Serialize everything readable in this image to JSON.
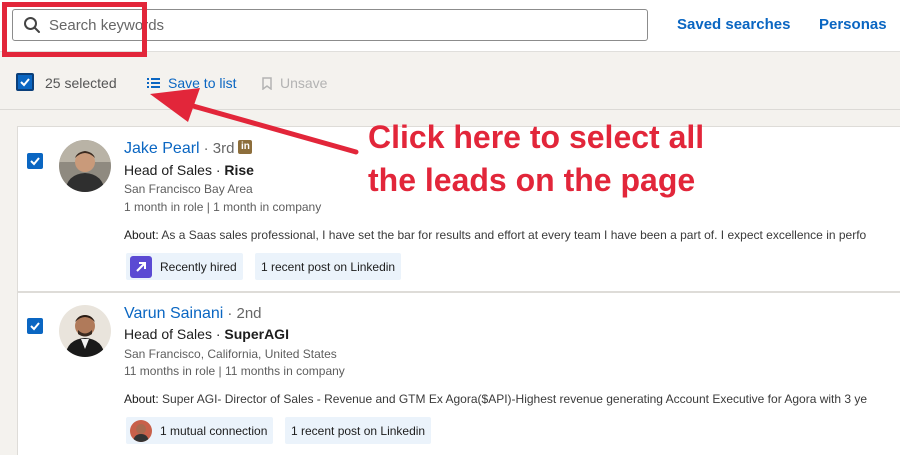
{
  "search": {
    "placeholder": "Search keywords"
  },
  "nav": {
    "saved_searches": "Saved searches",
    "personas": "Personas"
  },
  "toolbar": {
    "selected_label": "25 selected",
    "save_to_list": "Save to list",
    "unsave": "Unsave"
  },
  "annotation": {
    "line1": "Click here to select all",
    "line2": "the leads on the page",
    "color": "#e2263a"
  },
  "leads": [
    {
      "name": "Jake Pearl",
      "degree": "· 3rd",
      "role": "Head of Sales · ",
      "company": "Rise",
      "location": "San Francisco Bay Area",
      "tenure": "1 month in role | 1 month in company",
      "about_label": "About:",
      "about": "As a Saas sales professional, I have set the bar for results and effort at every team I have been a part of. I expect excellence in perfo",
      "tags": [
        "Recently hired",
        "1 recent post on Linkedin"
      ]
    },
    {
      "name": "Varun Sainani",
      "degree": "· 2nd",
      "role": "Head of Sales · ",
      "company": "SuperAGI",
      "location": "San Francisco, California, United States",
      "tenure": "11 months in role | 11 months in company",
      "about_label": "About:",
      "about": "Super AGI- Director of Sales - Revenue and GTM Ex Agora($API)-Highest revenue generating Account Executive for Agora with 3 ye",
      "tags": [
        "1 mutual connection",
        "1 recent post on Linkedin"
      ]
    }
  ],
  "colors": {
    "accent": "#0a66c2",
    "highlight": "#e2263a"
  }
}
